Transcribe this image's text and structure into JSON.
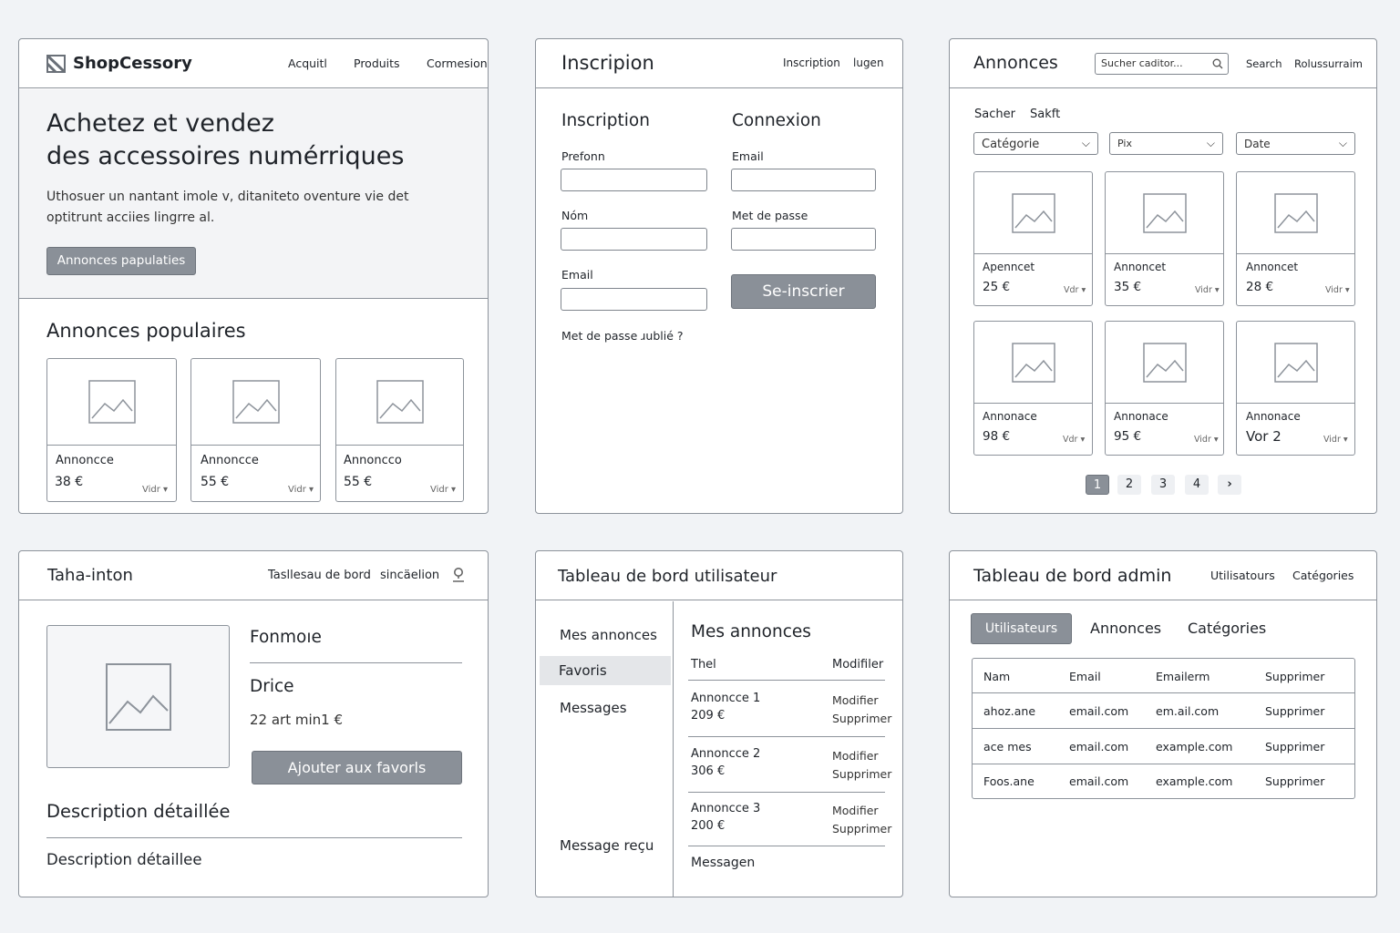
{
  "home": {
    "brand": "ShopCessory",
    "nav": [
      "Acquitl",
      "Produits",
      "Cormesion"
    ],
    "hero_title_1": "Achetez et vendez",
    "hero_title_2": "des accessoires numérriques",
    "hero_text_1": "Uthosuer un nantant  imole v, ditaniteto oventure vie det",
    "hero_text_2": "optitrunt acciies lingrre al.",
    "hero_button": "Annonces papulaties",
    "popular_title": "Annonces populaires",
    "cards": [
      {
        "title": "Annoncce",
        "price": "38 €",
        "more": "Vidr"
      },
      {
        "title": "Annoncce",
        "price": "55 €",
        "more": "Vidr"
      },
      {
        "title": "Annoncco",
        "price": "55 €",
        "more": "Vidr"
      }
    ]
  },
  "register": {
    "header_title": "Inscripion",
    "nav": [
      "Inscription",
      "lugen"
    ],
    "form_title": "Inscription",
    "login_title": "Connexion",
    "fields_left": [
      "Prefonn",
      "Nóm",
      "Email"
    ],
    "fields_right": [
      "Email",
      "Met de passe"
    ],
    "submit": "Se-inscrier",
    "forgot": "Met de passe ɹublié ?"
  },
  "listings": {
    "header_title": "Annonces",
    "search_placeholder": "Sucher caditor...",
    "nav": [
      "Search",
      "Rolussurraim"
    ],
    "tabs": [
      "Sacher",
      "Sakft"
    ],
    "filters": [
      "Catégorie",
      "Pix",
      "Date"
    ],
    "cards": [
      {
        "title": "Apenncet",
        "price": "25 €",
        "more": "Vdr"
      },
      {
        "title": "Annoncet",
        "price": "35 €",
        "more": "Vidr"
      },
      {
        "title": "Annoncet",
        "price": "28 €",
        "more": "Vidr"
      },
      {
        "title": "Annonace",
        "price": "98 €",
        "more": "Vdr"
      },
      {
        "title": "Annonace",
        "price": "95 €",
        "more": "Vidr"
      },
      {
        "title": "Annonace",
        "price": "Vor 2",
        "more": "Vidr"
      }
    ],
    "pages": [
      "1",
      "2",
      "3",
      "4",
      "›"
    ]
  },
  "detail": {
    "header_title": "Taha-inton",
    "nav": [
      "Tasllesau de bord",
      "sincäelion"
    ],
    "product_title": "Fonmoıe",
    "price_label": "Drice",
    "price_value": "22 art min1 €",
    "button": "Ajouter aux favorls",
    "desc_title": "Description détaillée",
    "desc_text": "Description détaillee"
  },
  "user_dashboard": {
    "header_title": "Tableau de bord utilisateur",
    "sidebar": [
      "Mes annonces",
      "Favoris",
      "Messages",
      "Message reçu"
    ],
    "main_title": "Mes annonces",
    "col_title": "Thel",
    "col_action": "Modifiler",
    "rows": [
      {
        "name": "Annoncce 1",
        "price": "209 €",
        "edit": "Modifier",
        "delete": "Supprimer"
      },
      {
        "name": "Annoncce 2",
        "price": "306 €",
        "edit": "Modifier",
        "delete": "Supprimer"
      },
      {
        "name": "Annoncce 3",
        "price": "200 €",
        "edit": "Modifier",
        "delete": "Supprimer"
      }
    ],
    "footer": "Messagen"
  },
  "admin": {
    "header_title": "Tableau de bord admin",
    "nav": [
      "Utilisatours",
      "Catégories"
    ],
    "tabs": [
      "Utilisateurs",
      "Annonces",
      "Catégories"
    ],
    "columns": [
      "Nam",
      "Email",
      "Emailerm",
      "Supprimer"
    ],
    "rows": [
      [
        "ahoz.ane",
        "email.com",
        "em.ail.com",
        "Supprimer"
      ],
      [
        "ace mes",
        "email.com",
        "example.com",
        "Supprimer"
      ],
      [
        "Foos.ane",
        "email.com",
        "example.com",
        "Supprimer"
      ]
    ]
  }
}
